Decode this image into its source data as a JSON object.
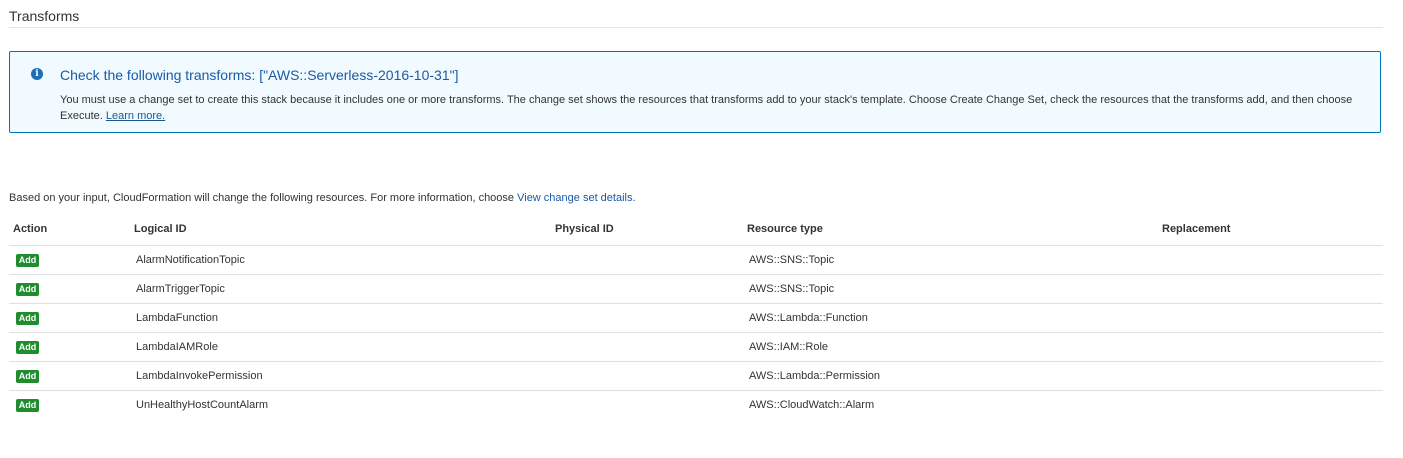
{
  "section": {
    "title": "Transforms"
  },
  "info": {
    "heading": "Check the following transforms: [\"AWS::Serverless-2016-10-31\"]",
    "body": "You must use a change set to create this stack because it includes one or more transforms. The change set shows the resources that transforms add to your stack's template. Choose Create Change Set, check the resources that the transforms add, and then choose Execute.",
    "link": "Learn more."
  },
  "intro": {
    "text": "Based on your input, CloudFormation will change the following resources. For more information, choose",
    "link": "View change set details."
  },
  "table": {
    "headers": {
      "action": "Action",
      "logical_id": "Logical ID",
      "physical_id": "Physical ID",
      "resource_type": "Resource type",
      "replacement": "Replacement"
    },
    "rows": [
      {
        "action": "Add",
        "logical_id": "AlarmNotificationTopic",
        "physical_id": "",
        "resource_type": "AWS::SNS::Topic",
        "replacement": ""
      },
      {
        "action": "Add",
        "logical_id": "AlarmTriggerTopic",
        "physical_id": "",
        "resource_type": "AWS::SNS::Topic",
        "replacement": ""
      },
      {
        "action": "Add",
        "logical_id": "LambdaFunction",
        "physical_id": "",
        "resource_type": "AWS::Lambda::Function",
        "replacement": ""
      },
      {
        "action": "Add",
        "logical_id": "LambdaIAMRole",
        "physical_id": "",
        "resource_type": "AWS::IAM::Role",
        "replacement": ""
      },
      {
        "action": "Add",
        "logical_id": "LambdaInvokePermission",
        "physical_id": "",
        "resource_type": "AWS::Lambda::Permission",
        "replacement": ""
      },
      {
        "action": "Add",
        "logical_id": "UnHealthyHostCountAlarm",
        "physical_id": "",
        "resource_type": "AWS::CloudWatch::Alarm",
        "replacement": ""
      }
    ]
  },
  "icons": {
    "info": "info-circle-icon"
  },
  "colors": {
    "info_border": "#0073bb",
    "info_background": "#f1faff",
    "heading_blue": "#1a5aa5",
    "add_badge": "#1f8c2e"
  }
}
